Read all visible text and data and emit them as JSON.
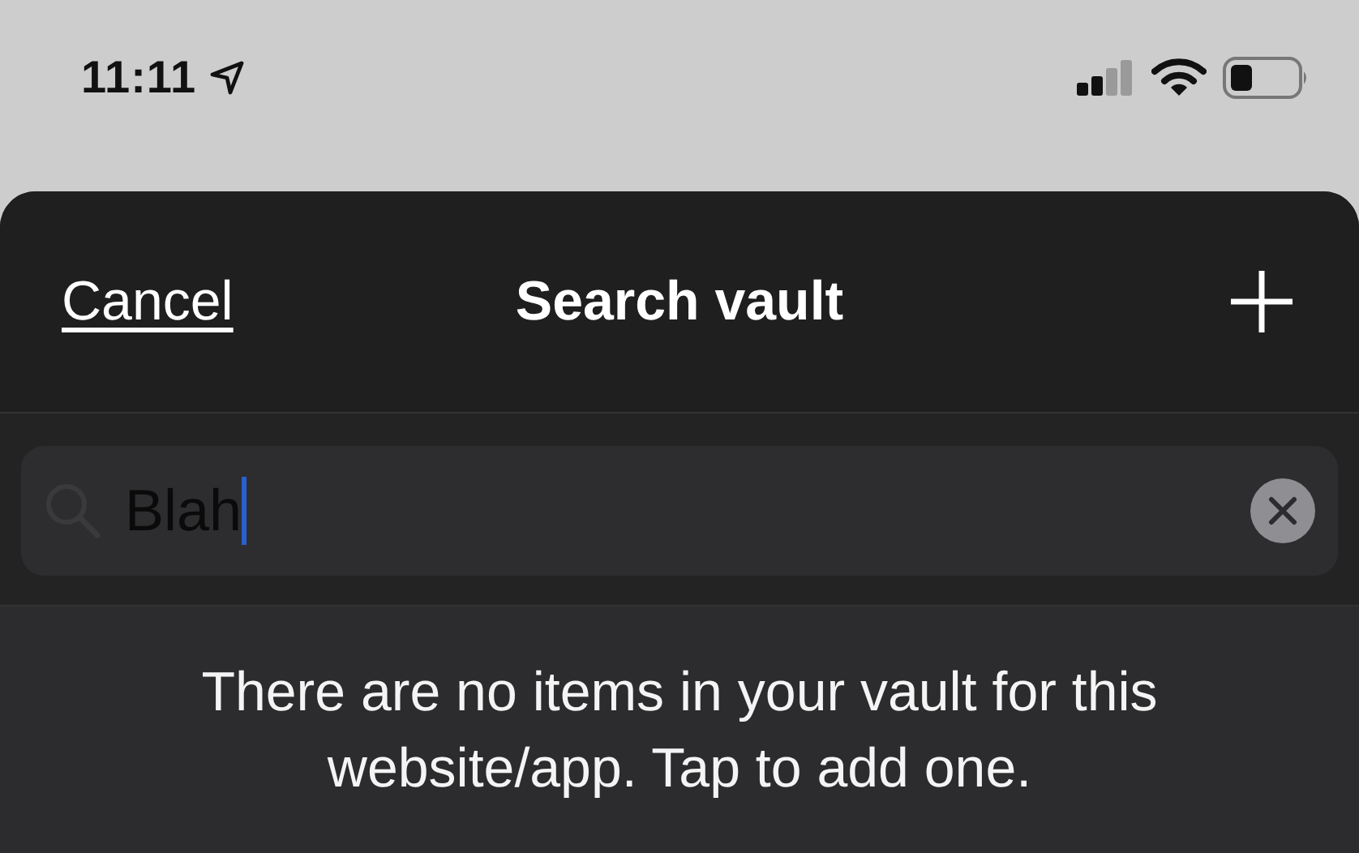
{
  "status_bar": {
    "time": "11:11"
  },
  "header": {
    "cancel": "Cancel",
    "title": "Search vault"
  },
  "search": {
    "value": "Blah"
  },
  "message": "There are no items in your vault for this website/app. Tap to add one."
}
